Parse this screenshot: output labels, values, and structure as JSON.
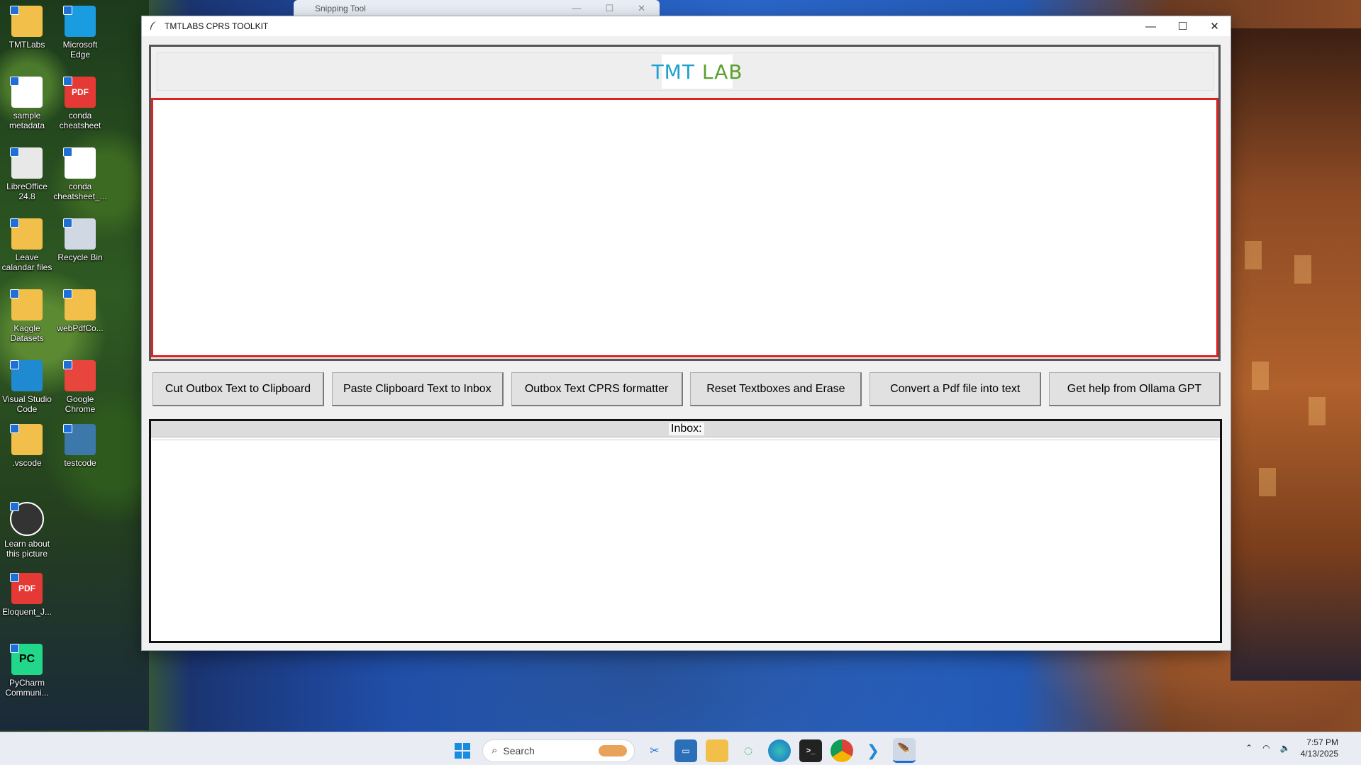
{
  "desktop": {
    "icons": [
      {
        "label": "TMTLabs",
        "icon": "folder-icon",
        "color": "#f2c04a"
      },
      {
        "label": "Microsoft Edge",
        "icon": "edge-icon",
        "color": "#1a9de0"
      },
      {
        "label": "sample metadata",
        "icon": "document-icon",
        "color": "#ffffff"
      },
      {
        "label": "conda cheatsheet",
        "icon": "pdf-icon",
        "color": "#e53935"
      },
      {
        "label": "LibreOffice 24.8",
        "icon": "libreoffice-icon",
        "color": "#e8e8e8"
      },
      {
        "label": "conda cheatsheet_...",
        "icon": "document-icon",
        "color": "#ffffff"
      },
      {
        "label": "Leave calandar files",
        "icon": "folder-icon",
        "color": "#f2c04a"
      },
      {
        "label": "Recycle Bin",
        "icon": "recycle-bin-icon",
        "color": "#cfd8e3"
      },
      {
        "label": "Kaggle Datasets",
        "icon": "folder-icon",
        "color": "#f2c04a"
      },
      {
        "label": "webPdfCo...",
        "icon": "folder-icon",
        "color": "#f2c04a"
      },
      {
        "label": "Visual Studio Code",
        "icon": "vscode-icon",
        "color": "#1f8ad2"
      },
      {
        "label": "Google Chrome",
        "icon": "chrome-icon",
        "color": "#e8453c"
      },
      {
        "label": ".vscode",
        "icon": "folder-icon",
        "color": "#f2c04a"
      },
      {
        "label": "testcode",
        "icon": "python-file-icon",
        "color": "#3c78aa"
      },
      {
        "label": "Learn about this picture",
        "icon": "camera-icon",
        "color": "#333333"
      },
      {
        "label": "Eloquent_J...",
        "icon": "pdf-icon",
        "color": "#e53935"
      },
      {
        "label": "PyCharm Communi...",
        "icon": "pycharm-icon",
        "color": "#21d789"
      }
    ]
  },
  "snipping": {
    "title": "Snipping Tool",
    "min": "—",
    "max": "☐",
    "close": "✕"
  },
  "window": {
    "title": "TMTLABS CPRS TOOLKIT",
    "min": "—",
    "max": "☐",
    "close": "✕",
    "logo_left": "TMT",
    "logo_right": "LAB"
  },
  "buttons": [
    "Cut Outbox Text to Clipboard",
    "Paste Clipboard Text to Inbox",
    "Outbox Text CPRS formatter",
    "Reset Textboxes and Erase",
    "Convert a Pdf file into text",
    "Get help from Ollama GPT"
  ],
  "inbox": {
    "label": "Inbox:"
  },
  "taskbar": {
    "search_placeholder": "Search",
    "time": "7:57 PM",
    "date": "4/13/2025"
  }
}
